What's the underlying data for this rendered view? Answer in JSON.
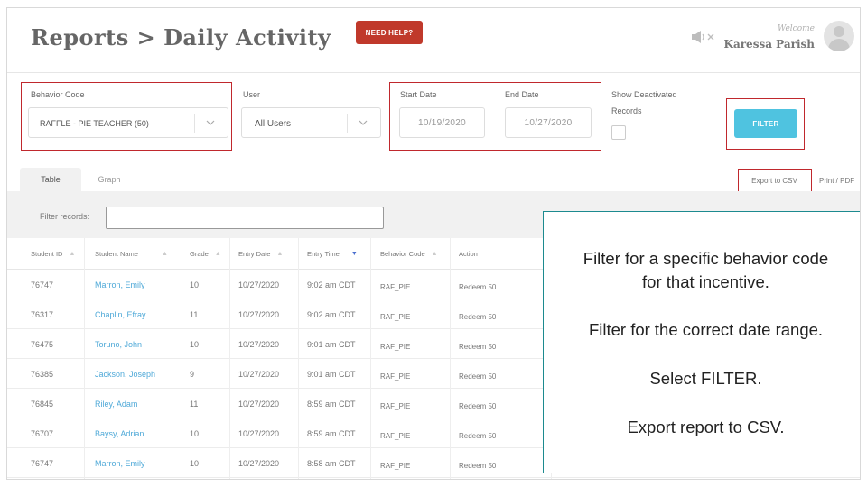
{
  "header": {
    "title": "Reports > Daily Activity",
    "help_label": "NEED HELP?",
    "welcome_label": "Welcome",
    "user_name": "Karessa Parish",
    "mute_icon": "speaker-mute-icon",
    "avatar_icon": "user-avatar-icon"
  },
  "filters": {
    "behavior_code": {
      "label": "Behavior Code",
      "value": "RAFFLE - PIE TEACHER (50)"
    },
    "user": {
      "label": "User",
      "value": "All Users"
    },
    "start_date": {
      "label": "Start Date",
      "value": "10/19/2020"
    },
    "end_date": {
      "label": "End Date",
      "value": "10/27/2020"
    },
    "show_deactivated": {
      "label_line1": "Show Deactivated",
      "label_line2": "Records",
      "checked": false
    },
    "filter_button": "FILTER"
  },
  "tabs": [
    {
      "label": "Table",
      "active": true
    },
    {
      "label": "Graph",
      "active": false
    }
  ],
  "export": {
    "csv_label": "Export to CSV",
    "print_label": "Print / PDF"
  },
  "filter_records": {
    "label": "Filter records:",
    "value": ""
  },
  "table": {
    "columns": [
      "Student ID",
      "Student Name",
      "Grade",
      "Entry Date",
      "Entry Time",
      "Behavior Code",
      "Action"
    ],
    "rows": [
      [
        "76747",
        "Marron, Emily",
        "10",
        "10/27/2020",
        "9:02 am CDT",
        "RAF_PIE",
        "Redeem 50"
      ],
      [
        "76317",
        "Chaplin, Efray",
        "11",
        "10/27/2020",
        "9:02 am CDT",
        "RAF_PIE",
        "Redeem 50"
      ],
      [
        "76475",
        "Toruno, John",
        "10",
        "10/27/2020",
        "9:01 am CDT",
        "RAF_PIE",
        "Redeem 50"
      ],
      [
        "76385",
        "Jackson, Joseph",
        "9",
        "10/27/2020",
        "9:01 am CDT",
        "RAF_PIE",
        "Redeem 50"
      ],
      [
        "76845",
        "Riley, Adam",
        "11",
        "10/27/2020",
        "8:59 am CDT",
        "RAF_PIE",
        "Redeem 50"
      ],
      [
        "76707",
        "Baysy, Adrian",
        "10",
        "10/27/2020",
        "8:59 am CDT",
        "RAF_PIE",
        "Redeem 50"
      ],
      [
        "76747",
        "Marron, Emily",
        "10",
        "10/27/2020",
        "8:58 am CDT",
        "RAF_PIE",
        "Redeem 50"
      ]
    ]
  },
  "callout": {
    "line1": "Filter for a specific behavior code",
    "line2": "for that incentive.",
    "line3": "Filter for the correct date range.",
    "line4": "Select FILTER.",
    "line5": "Export report to CSV."
  },
  "colors": {
    "accent": "#4fc3e0",
    "help": "#c0392b",
    "highlight_box": "#c0282d",
    "callout_border": "#1c8a8f",
    "link": "#4fa9d8"
  }
}
